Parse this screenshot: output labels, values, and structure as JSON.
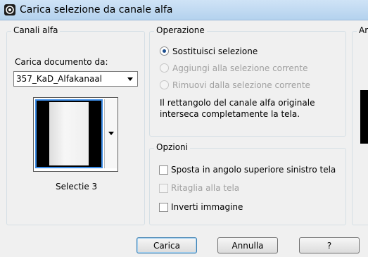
{
  "window": {
    "title": "Carica selezione da canale alfa"
  },
  "canali": {
    "legend": "Canali alfa",
    "load_label": "Carica documento da:",
    "document": "357_KaD_Alfakanaal",
    "preview_caption": "Selectie 3"
  },
  "operazione": {
    "legend": "Operazione",
    "options": [
      {
        "label": "Sostituisci selezione",
        "selected": true,
        "enabled": true
      },
      {
        "label": "Aggiungi alla selezione corrente",
        "selected": false,
        "enabled": false
      },
      {
        "label": "Rimuovi dalla selezione corrente",
        "selected": false,
        "enabled": false
      }
    ],
    "info": [
      "Il rettangolo del canale alfa originale",
      "interseca completamente la tela."
    ]
  },
  "opzioni": {
    "legend": "Opzioni",
    "items": [
      {
        "label": "Sposta in angolo superiore sinistro tela",
        "checked": false,
        "enabled": true
      },
      {
        "label": "Ritaglia alla tela",
        "checked": false,
        "enabled": false
      },
      {
        "label": "Inverti immagine",
        "checked": false,
        "enabled": true
      }
    ]
  },
  "right_panel": {
    "legend_fragment": "Ar"
  },
  "buttons": {
    "ok": "Carica",
    "cancel": "Annulla",
    "help": "?"
  }
}
